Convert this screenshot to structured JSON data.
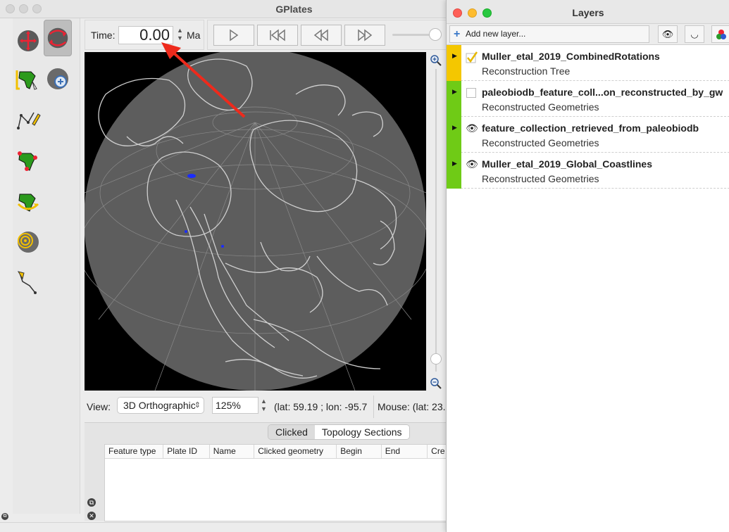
{
  "main_window": {
    "title": "GPlates"
  },
  "time": {
    "label": "Time:",
    "value": "0.00",
    "unit": "Ma"
  },
  "tools": [
    {
      "name": "drag-globe"
    },
    {
      "name": "zoom-globe"
    },
    {
      "name": "choose-feature"
    },
    {
      "name": "digitise"
    },
    {
      "name": "edit-topology"
    },
    {
      "name": "pole-manipulation"
    },
    {
      "name": "small-circle"
    },
    {
      "name": "measure-distance"
    }
  ],
  "status": {
    "view_label": "View:",
    "projection": "3D Orthographic",
    "zoom": "125%",
    "camera_coords": "(lat: 59.19 ; lon: -95.7",
    "mouse_coords": "Mouse: (lat: 23."
  },
  "bottom_panel": {
    "tabs": [
      "Clicked",
      "Topology Sections"
    ],
    "selected_tab": 0,
    "columns": [
      "Feature type",
      "Plate ID",
      "Name",
      "Clicked geometry",
      "Begin",
      "End",
      "Cre"
    ]
  },
  "layers_window": {
    "title": "Layers",
    "add_layer_label": "Add new layer...",
    "layers": [
      {
        "name": "Muller_etal_2019_CombinedRotations",
        "type": "Reconstruction Tree",
        "color": "#f4c700",
        "state": "checked"
      },
      {
        "name": "paleobiodb_feature_coll...on_reconstructed_by_gw",
        "type": "Reconstructed Geometries",
        "color": "#6fcb16",
        "state": "unchecked"
      },
      {
        "name": "feature_collection_retrieved_from_paleobiodb",
        "type": "Reconstructed Geometries",
        "color": "#6fcb16",
        "state": "visible"
      },
      {
        "name": "Muller_etal_2019_Global_Coastlines",
        "type": "Reconstructed Geometries",
        "color": "#6fcb16",
        "state": "visible"
      }
    ]
  },
  "colors": {
    "globe": "#5d5d5d",
    "coastline": "#cfcfcf",
    "annotation_arrow": "#ee2a1c",
    "points": "#1a2cff"
  }
}
